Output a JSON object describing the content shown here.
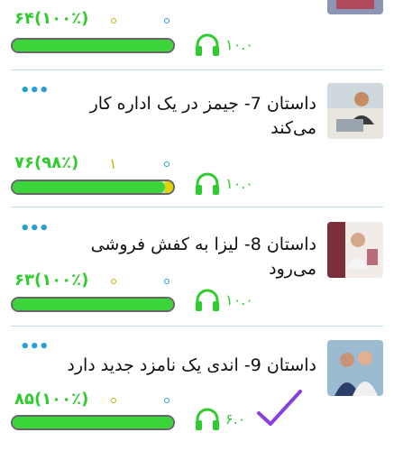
{
  "items": [
    {
      "title": "",
      "score": "۶۴(۱۰۰٪)",
      "stars": "",
      "progress": 1.0,
      "duration": "۱۰.۰",
      "completed": false,
      "thumb": "people-photo"
    },
    {
      "title": "داستان 7- جیمز در یک اداره کار می‌کند",
      "score": "۷۶(۹۸٪)",
      "stars": "۱",
      "progress": 0.98,
      "duration": "۱۰.۰",
      "completed": false,
      "thumb": "office-man-photo"
    },
    {
      "title": "داستان 8- لیزا به کفش فروشی می‌رود",
      "score": "۶۳(۱۰۰٪)",
      "stars": "",
      "progress": 1.0,
      "duration": "۱۰.۰",
      "completed": false,
      "thumb": "shoe-shop-photo"
    },
    {
      "title": "داستان 9- اندی یک نامزد جدید دارد",
      "score": "۸۵(۱۰۰٪)",
      "stars": "",
      "progress": 1.0,
      "duration": "۶.۰",
      "completed": true,
      "thumb": "couple-photo"
    }
  ],
  "more_label": "•••",
  "icons": {
    "audio": "headphones-icon",
    "done": "checkmark-icon",
    "menu": "more-dots-icon"
  },
  "colors": {
    "green": "#3bd43b",
    "blue": "#2a9fd6",
    "yellow": "#c8b400",
    "purple": "#8a3fe0"
  }
}
